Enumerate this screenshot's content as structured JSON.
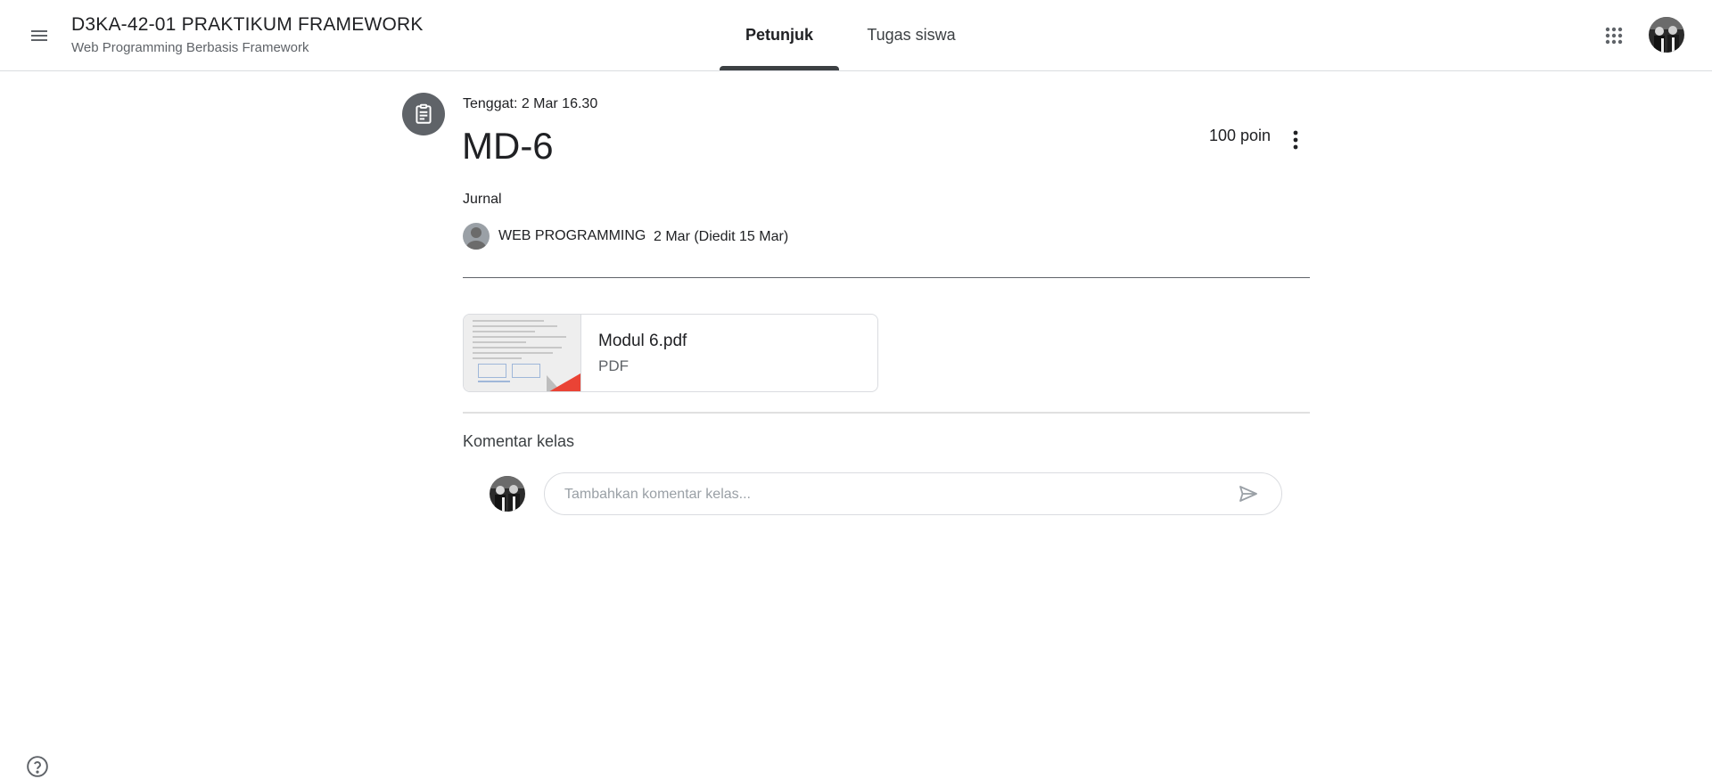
{
  "header": {
    "class_title": "D3KA-42-01 PRAKTIKUM FRAMEWORK",
    "class_subtitle": "Web Programming Berbasis Framework",
    "tabs": [
      {
        "label": "Petunjuk",
        "active": true
      },
      {
        "label": "Tugas siswa",
        "active": false
      }
    ],
    "icons": {
      "menu": "hamburger-menu-icon",
      "apps": "google-apps-grid-icon",
      "account": "account-avatar"
    }
  },
  "assignment": {
    "icon": "assignment-clipboard-icon",
    "due": "Tenggat: 2 Mar 16.30",
    "title": "MD-6",
    "points": "100 poin",
    "topic": "Jurnal",
    "author": "WEB PROGRAMMING",
    "posted": "2 Mar (Diedit 15 Mar)"
  },
  "attachment": {
    "name": "Modul 6.pdf",
    "type": "PDF",
    "accent": "#ea4335"
  },
  "comments": {
    "title": "Komentar kelas",
    "placeholder": "Tambahkan komentar kelas...",
    "send_icon": "send-icon"
  },
  "footer": {
    "help_icon": "help-icon"
  },
  "colors": {
    "text_primary": "#202124",
    "text_secondary": "#5f6368",
    "border": "#dadce0",
    "icon_circle": "#5f6368"
  }
}
